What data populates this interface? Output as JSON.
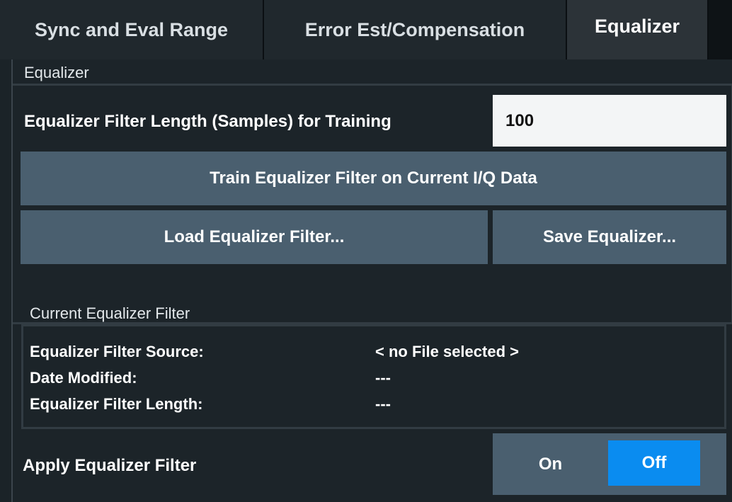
{
  "tabs": [
    {
      "label": "Sync and Eval Range"
    },
    {
      "label": "Error Est/Compensation"
    },
    {
      "label": "Equalizer"
    }
  ],
  "equalizer_group": {
    "title": "Equalizer",
    "filter_length_label": "Equalizer Filter Length (Samples) for Training",
    "filter_length_value": "100",
    "train_button": "Train Equalizer Filter on Current I/Q Data",
    "load_button": "Load Equalizer Filter...",
    "save_button": "Save Equalizer..."
  },
  "current_filter": {
    "title": "Current Equalizer Filter",
    "rows": [
      {
        "label": "Equalizer Filter Source:",
        "value": "< no File selected >"
      },
      {
        "label": "Date Modified:",
        "value": "---"
      },
      {
        "label": "Equalizer Filter Length:",
        "value": "---"
      }
    ]
  },
  "apply": {
    "label": "Apply Equalizer Filter",
    "on_label": "On",
    "off_label": "Off",
    "selected": "Off"
  },
  "colors": {
    "accent": "#0a8cf0",
    "button": "#4a5f6f",
    "background": "#1c2429"
  }
}
